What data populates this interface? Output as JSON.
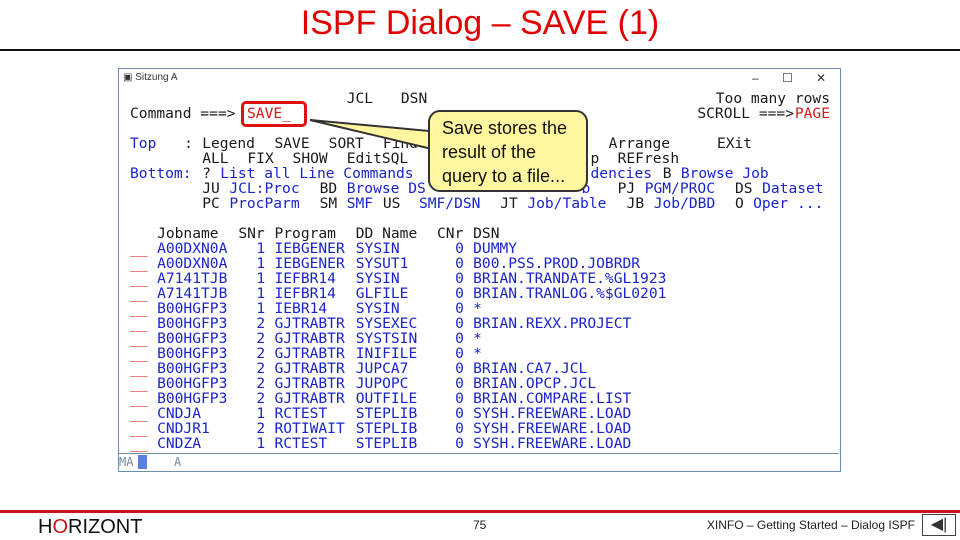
{
  "slide": {
    "title": "ISPF Dialog – SAVE (1)",
    "page_number": "75",
    "footer_text": "XINFO – Getting Started – Dialog ISPF",
    "logo_pre": "H",
    "logo_o": "O",
    "logo_post": "RIZONT",
    "back_icon": "◀|",
    "accent": "#c8141c"
  },
  "window": {
    "title": "Sitzung A",
    "minimize": "–",
    "maximize": "☐",
    "close": "✕"
  },
  "terminal": {
    "header_labels": [
      {
        "text": "JCL",
        "col": 24,
        "row": 0
      },
      {
        "text": "DSN",
        "col": 30,
        "row": 0
      }
    ],
    "message": "Too many rows",
    "command_label": "Command ===>",
    "command_value": "SAVE_",
    "scroll_label": "SCROLL ===>",
    "scroll_value": "PAGE",
    "menu": [
      [
        {
          "t": "Top",
          "c": 0,
          "k": "blue"
        },
        {
          "t": ":",
          "c": 6,
          "k": "blk"
        },
        {
          "t": "Legend",
          "c": 8,
          "k": "blk"
        },
        {
          "t": "SAVE",
          "c": 16,
          "k": "blk"
        },
        {
          "t": "SORT",
          "c": 22,
          "k": "blk"
        },
        {
          "t": "Find",
          "c": 28,
          "k": "blk"
        },
        {
          "t": "Arrange",
          "c": 53,
          "k": "blk"
        },
        {
          "t": "EXit",
          "c": 65,
          "k": "blk"
        }
      ],
      [
        {
          "t": "ALL",
          "c": 8,
          "k": "blk"
        },
        {
          "t": "FIX",
          "c": 13,
          "k": "blk"
        },
        {
          "t": "SHOW",
          "c": 18,
          "k": "blk"
        },
        {
          "t": "EditSQL",
          "c": 24,
          "k": "blk"
        },
        {
          "t": "p",
          "c": 51,
          "k": "blk"
        },
        {
          "t": "REFresh",
          "c": 54,
          "k": "blk"
        }
      ],
      [
        {
          "t": "Bottom:",
          "c": 0,
          "k": "blue"
        },
        {
          "t": "?",
          "c": 8,
          "k": "blk"
        },
        {
          "t": "List all Line Commands",
          "c": 10,
          "k": "blue"
        },
        {
          "t": "dencies",
          "c": 51,
          "k": "blue"
        },
        {
          "t": "B",
          "c": 59,
          "k": "blk"
        },
        {
          "t": "Browse Job",
          "c": 61,
          "k": "blue"
        }
      ],
      [
        {
          "t": "JU",
          "c": 8,
          "k": "blk"
        },
        {
          "t": "JCL:Proc",
          "c": 11,
          "k": "blue"
        },
        {
          "t": "BD",
          "c": 21,
          "k": "blk"
        },
        {
          "t": "Browse DS",
          "c": 24,
          "k": "blue"
        },
        {
          "t": "b",
          "c": 50,
          "k": "blue"
        },
        {
          "t": "PJ",
          "c": 54,
          "k": "blk"
        },
        {
          "t": "PGM/PROC",
          "c": 57,
          "k": "blue"
        },
        {
          "t": "DS",
          "c": 67,
          "k": "blk"
        },
        {
          "t": "Dataset",
          "c": 70,
          "k": "blue"
        }
      ],
      [
        {
          "t": "PC",
          "c": 8,
          "k": "blk"
        },
        {
          "t": "ProcParm",
          "c": 11,
          "k": "blue"
        },
        {
          "t": "SM",
          "c": 21,
          "k": "blk"
        },
        {
          "t": "SMF",
          "c": 24,
          "k": "blue"
        },
        {
          "t": "US",
          "c": 28,
          "k": "blk"
        },
        {
          "t": "SMF/DSN",
          "c": 32,
          "k": "blue"
        },
        {
          "t": "JT",
          "c": 41,
          "k": "blk"
        },
        {
          "t": "Job/Table",
          "c": 44,
          "k": "blue"
        },
        {
          "t": "JB",
          "c": 55,
          "k": "blk"
        },
        {
          "t": "Job/DBD",
          "c": 58,
          "k": "blue"
        },
        {
          "t": "O",
          "c": 67,
          "k": "blk"
        },
        {
          "t": "Oper ...",
          "c": 69,
          "k": "blue"
        }
      ]
    ],
    "columns": [
      "Jobname",
      "SNr",
      "Program",
      "DD Name",
      "CNr",
      "DSN"
    ],
    "line_cmd_placeholder": "__",
    "rows": [
      [
        "A00DXN0A",
        "1",
        "IEBGENER",
        "SYSIN",
        "0",
        "DUMMY"
      ],
      [
        "A00DXN0A",
        "1",
        "IEBGENER",
        "SYSUT1",
        "0",
        "B00.PSS.PROD.JOBRDR"
      ],
      [
        "A7141TJB",
        "1",
        "IEFBR14",
        "SYSIN",
        "0",
        "BRIAN.TRANDATE.%GL1923"
      ],
      [
        "A7141TJB",
        "1",
        "IEFBR14",
        "GLFILE",
        "0",
        "BRIAN.TRANLOG.%$GL0201"
      ],
      [
        "B00HGFP3",
        "1",
        "IEBR14",
        "SYSIN",
        "0",
        "*"
      ],
      [
        "B00HGFP3",
        "2",
        "GJTRABTR",
        "SYSEXEC",
        "0",
        "BRIAN.REXX.PROJECT"
      ],
      [
        "B00HGFP3",
        "2",
        "GJTRABTR",
        "SYSTSIN",
        "0",
        "*"
      ],
      [
        "B00HGFP3",
        "2",
        "GJTRABTR",
        "INIFILE",
        "0",
        "*"
      ],
      [
        "B00HGFP3",
        "2",
        "GJTRABTR",
        "JUPCA7",
        "0",
        "BRIAN.CA7.JCL"
      ],
      [
        "B00HGFP3",
        "2",
        "GJTRABTR",
        "JUPOPC",
        "0",
        "BRIAN.OPCP.JCL"
      ],
      [
        "B00HGFP3",
        "2",
        "GJTRABTR",
        "OUTFILE",
        "0",
        "BRIAN.COMPARE.LIST"
      ],
      [
        "CNDJA",
        "1",
        "RCTEST",
        "STEPLIB",
        "0",
        "SYSH.FREEWARE.LOAD"
      ],
      [
        "CNDJR1",
        "2",
        "ROTIWAIT",
        "STEPLIB",
        "0",
        "SYSH.FREEWARE.LOAD"
      ],
      [
        "CNDZA",
        "1",
        "RCTEST",
        "STEPLIB",
        "0",
        "SYSH.FREEWARE.LOAD"
      ]
    ],
    "status_left": "MA",
    "status_session": "A"
  },
  "callout": {
    "text": "Save stores the result of the query to a file..."
  }
}
